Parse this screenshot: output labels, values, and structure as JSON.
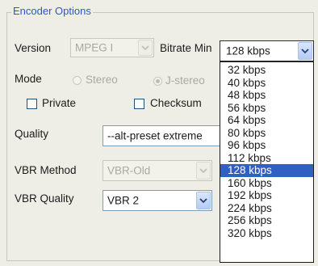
{
  "group_title": "Encoder Options",
  "version": {
    "label": "Version",
    "value": "MPEG I"
  },
  "bitrate_min": {
    "label": "Bitrate Min",
    "value": "128 kbps",
    "options": [
      "32 kbps",
      "40 kbps",
      "48 kbps",
      "56 kbps",
      "64 kbps",
      "80 kbps",
      "96 kbps",
      "112 kbps",
      "128 kbps",
      "160 kbps",
      "192 kbps",
      "224 kbps",
      "256 kbps",
      "320 kbps"
    ],
    "selected_index": 8
  },
  "mode": {
    "label": "Mode",
    "stereo_label": "Stereo",
    "jstereo_label": "J-stereo"
  },
  "private_label": "Private",
  "checksum_label": "Checksum",
  "quality": {
    "label": "Quality",
    "value": "--alt-preset extreme"
  },
  "vbr_method": {
    "label": "VBR Method",
    "value": "VBR-Old"
  },
  "vbr_quality": {
    "label": "VBR Quality",
    "value": "VBR 2"
  }
}
